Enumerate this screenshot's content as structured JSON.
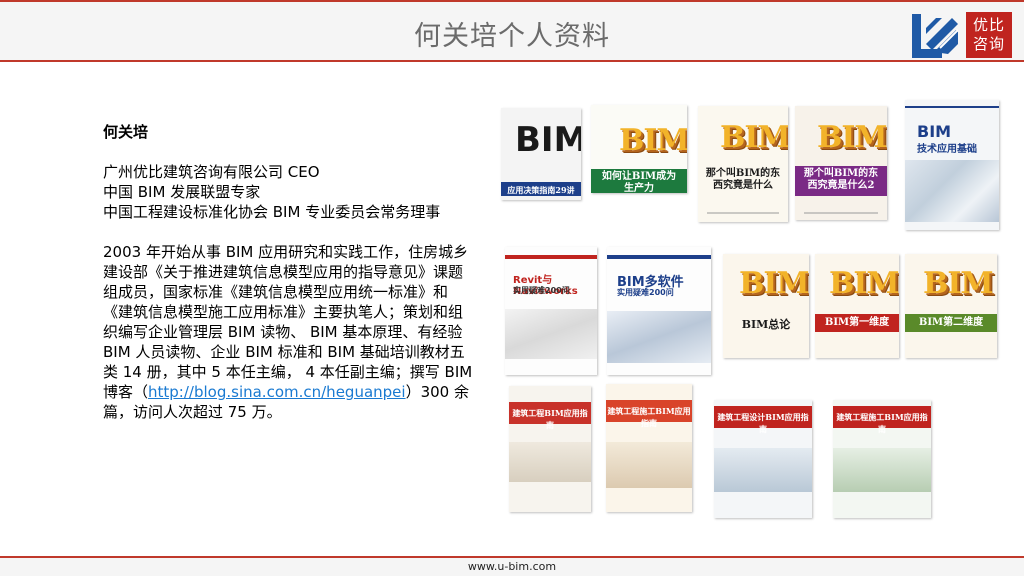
{
  "header": {
    "title": "何关培个人资料",
    "logo_icon": "ubim-logo-icon",
    "brand_line1": "优比",
    "brand_line2": "咨询",
    "brand_color": "#c0241f",
    "accent_line_color": "#c0392b"
  },
  "bio": {
    "name": "何关培",
    "titles": [
      "广州优比建筑咨询有限公司 CEO",
      "中国 BIM 发展联盟专家",
      "中国工程建设标准化协会 BIM 专业委员会常务理事"
    ],
    "description_main": "2003 年开始从事 BIM 应用研究和实践工作，住房城乡建设部《关于推进建筑信息模型应用的指导意见》课题组成员，国家标准《建筑信息模型应用统一标准》和《建筑信息模型施工应用标准》主要执笔人；策划和组织编写企业管理层 BIM 读物、 BIM 基本原理、有经验 BIM 人员读物、企业 BIM 标准和 BIM 基础培训教材五类 14 册，其中 5 本任主编， 4 本任副主编；撰写 BIM 博客（",
    "blog_url": "http://blog.sina.com.cn/heguanpei",
    "description_end": "）300 余篇，访问人次超过 75 万。"
  },
  "books": [
    {
      "big": "BIM",
      "title": "应用决策指南29讲"
    },
    {
      "big": "BIM",
      "title": "如何让BIM成为生产力"
    },
    {
      "big": "BIM",
      "title": "那个叫BIM的东西究竟是什么"
    },
    {
      "big": "BIM",
      "title": "那个叫BIM的东西究竟是什么2"
    },
    {
      "big": "BIM",
      "title": "技术应用基础"
    },
    {
      "big": "Revit与Navisworks",
      "title": "实用疑难200问"
    },
    {
      "big": "BIM多软件",
      "title": "实用疑难200问"
    },
    {
      "big": "BIM",
      "title": "BIM总论"
    },
    {
      "big": "BIM",
      "title": "BIM第一维度"
    },
    {
      "big": "BIM",
      "title": "BIM第二维度"
    },
    {
      "big": "",
      "title": "建筑工程BIM应用指南"
    },
    {
      "big": "",
      "title": "建筑工程施工BIM应用指南"
    },
    {
      "big": "",
      "title": "建筑工程设计BIM应用指南"
    },
    {
      "big": "",
      "title": "建筑工程施工BIM应用指南"
    }
  ],
  "footer": {
    "url": "www.u-bim.com"
  }
}
